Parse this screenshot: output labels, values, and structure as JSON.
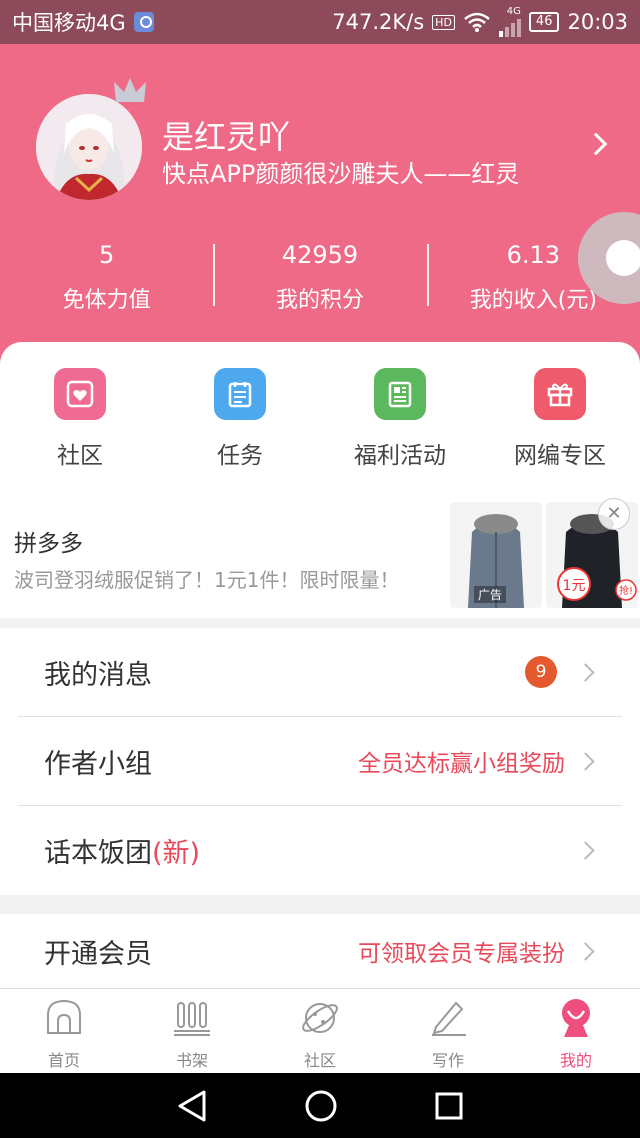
{
  "status_bar": {
    "carrier": "中国移动4G",
    "speed": "747.2K/s",
    "hd": "HD",
    "net": "4G",
    "battery": "46",
    "time": "20:03"
  },
  "profile": {
    "nickname": "是红灵吖",
    "signature": "快点APP颜颜很沙雕夫人——红灵"
  },
  "stats": [
    {
      "value": "5",
      "label": "免体力值"
    },
    {
      "value": "42959",
      "label": "我的积分"
    },
    {
      "value": "6.13",
      "label": "我的收入(元)"
    }
  ],
  "grid": [
    {
      "label": "社区",
      "icon": "community-icon",
      "color": "#f06b93"
    },
    {
      "label": "任务",
      "icon": "task-icon",
      "color": "#4ea8ee"
    },
    {
      "label": "福利活动",
      "icon": "news-icon",
      "color": "#5cb85c"
    },
    {
      "label": "网编专区",
      "icon": "gift-icon",
      "color": "#ef5b6b"
    }
  ],
  "ad": {
    "title": "拼多多",
    "desc": "波司登羽绒服促销了！1元1件！限时限量！",
    "tag": "广告",
    "price_tag": "1元",
    "price_suffix": "抢!"
  },
  "menu": [
    {
      "label": "我的消息",
      "badge": "9",
      "hint": ""
    },
    {
      "label": "作者小组",
      "badge": "",
      "hint": "全员达标赢小组奖励"
    },
    {
      "label": "话本饭团",
      "suffix": "(新)",
      "badge": "",
      "hint": ""
    }
  ],
  "menu2": [
    {
      "label": "开通会员",
      "hint": "可领取会员专属装扮"
    }
  ],
  "bottom_nav": [
    {
      "label": "首页",
      "icon": "home-icon"
    },
    {
      "label": "书架",
      "icon": "bookshelf-icon"
    },
    {
      "label": "社区",
      "icon": "planet-icon"
    },
    {
      "label": "写作",
      "icon": "pen-icon"
    },
    {
      "label": "我的",
      "icon": "mine-icon",
      "active": true
    }
  ],
  "colors": {
    "header_bg": "#ee6a87",
    "accent_red": "#e84a5a",
    "badge": "#e45a2e",
    "nav_active": "#ef4f7e"
  }
}
